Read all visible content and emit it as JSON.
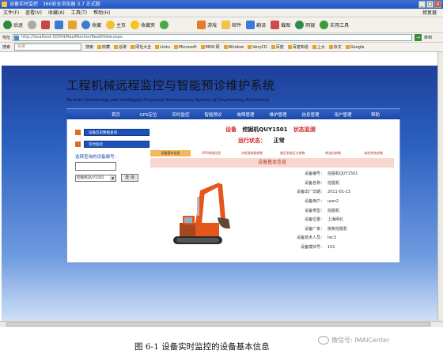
{
  "browser": {
    "title": "设备实时监控 - 360安全浏览器 3.7 正式版",
    "menu": [
      "文件(F)",
      "查看(V)",
      "收藏(A)",
      "工具(T)",
      "帮助(H)"
    ],
    "menu_right": "修复器",
    "toolbar": [
      "后退",
      "前进",
      "收藏",
      "主页",
      "收藏夹"
    ],
    "toolbar_right": [
      "游戏",
      "邮件",
      "翻译",
      "截图",
      "网银",
      "实用工具"
    ],
    "address": "http://localhost:50554/RealMonitor/RealDView.aspx",
    "go_label": "转到",
    "search_placeholder": "谷歌",
    "search_button": "搜索",
    "favorites": [
      "收藏",
      "谷歌",
      "网址大全",
      "Links",
      "Microsoft",
      "MSN 网",
      "Window",
      "VeryCD",
      "百度",
      "百度知道",
      "上大",
      "杂文",
      "Google"
    ]
  },
  "site": {
    "title": "工程机械远程监控与智能预诊维护系统",
    "subtitle": "Remote Monitoring and Intelligent Prognosis Maintenance System of Engineering Machinery",
    "nav": [
      "首页",
      "GPS定位",
      "实时监控",
      "智能预诊",
      "故障管理",
      "维护管理",
      "信息管理",
      "用户管理",
      "帮助"
    ],
    "side_buttons": [
      "设备历史数据查询",
      "实时监控"
    ],
    "query_label": "选择查询的设备编号：",
    "query_input": "",
    "query_select": "挖掘机QUY1501",
    "query_button": "查 询",
    "header_device_label": "设备",
    "header_device": "挖掘机QUY1501",
    "header_status_title": "状态监测",
    "header_run_label": "运行状态：",
    "header_run_value": "正常",
    "tabs": [
      "设备基本信息",
      "GPS地理信息",
      "力矩限制器参数",
      "液压系统压力参数",
      "柴油机参数",
      "电控系统参数"
    ],
    "section_title": "设备基本信息",
    "info": [
      {
        "k": "设备编号：",
        "v": "挖掘机QUY1501"
      },
      {
        "k": "设备名称：",
        "v": "挖掘机"
      },
      {
        "k": "设备出厂日期：",
        "v": "2011-01-13"
      },
      {
        "k": "设备用户：",
        "v": "user2"
      },
      {
        "k": "设备类型：",
        "v": "挖掘机"
      },
      {
        "k": "设备位置：",
        "v": "上海闸北"
      },
      {
        "k": "设备厂家：",
        "v": "挑柴挖掘机"
      },
      {
        "k": "设备技术人员：",
        "v": "tec3"
      },
      {
        "k": "设备模块号：",
        "v": "101"
      }
    ]
  },
  "caption": "图 6-1  设备实时监控的设备基本信息",
  "watermark": "微信号: IMAICenter",
  "colors": {
    "nav_blue": "#2451b8",
    "status_red": "#d42828",
    "tab_active": "#f2b85a",
    "section_pink": "#f9d7cf"
  }
}
